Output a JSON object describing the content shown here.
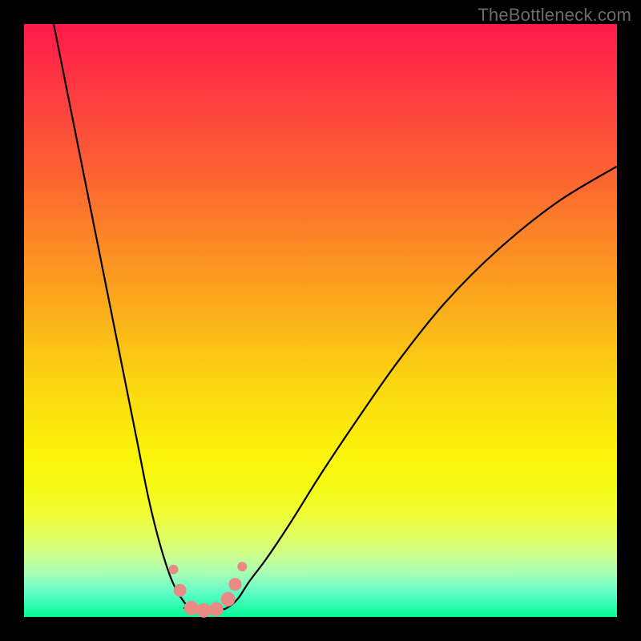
{
  "watermark": {
    "text": "TheBottleneck.com"
  },
  "colors": {
    "frame": "#000000",
    "curve": "#000000",
    "bead": "#e98b84"
  },
  "gradient_stops": [
    {
      "pct": 0,
      "color": "#fe1a4b"
    },
    {
      "pct": 12,
      "color": "#fd3d40"
    },
    {
      "pct": 28,
      "color": "#fc6b2f"
    },
    {
      "pct": 45,
      "color": "#fba31e"
    },
    {
      "pct": 60,
      "color": "#fbd412"
    },
    {
      "pct": 72,
      "color": "#fbf20a"
    },
    {
      "pct": 78,
      "color": "#f6fa14"
    },
    {
      "pct": 83,
      "color": "#edfc3a"
    },
    {
      "pct": 87,
      "color": "#dffe68"
    },
    {
      "pct": 90,
      "color": "#c8fe94"
    },
    {
      "pct": 93,
      "color": "#a0feb9"
    },
    {
      "pct": 96,
      "color": "#5cfec8"
    },
    {
      "pct": 100,
      "color": "#04fa94"
    }
  ],
  "chart_data": {
    "type": "line",
    "title": "",
    "xlabel": "",
    "ylabel": "",
    "xlim": [
      0,
      100
    ],
    "ylim": [
      0,
      100
    ],
    "grid": false,
    "legend_position": "none",
    "series": [
      {
        "name": "left-curve",
        "x": [
          5,
          7,
          9,
          11,
          13,
          15,
          17,
          19,
          21,
          23,
          25,
          27,
          28.5
        ],
        "y": [
          100,
          90,
          80,
          70,
          60,
          50,
          40,
          30,
          20,
          12,
          6,
          2.5,
          1.2
        ]
      },
      {
        "name": "right-curve",
        "x": [
          34,
          36,
          38,
          41,
          45,
          50,
          56,
          63,
          71,
          80,
          90,
          100
        ],
        "y": [
          1.4,
          3,
          6,
          10,
          16,
          24,
          33,
          43,
          53,
          62,
          70,
          76
        ]
      },
      {
        "name": "valley-floor",
        "x": [
          27,
          29,
          31,
          33
        ],
        "y": [
          1.5,
          1.0,
          1.0,
          1.4
        ]
      }
    ],
    "markers": [
      {
        "name": "left-bead-upper",
        "x": 25.2,
        "y": 8.0,
        "r": 6
      },
      {
        "name": "left-bead-lower",
        "x": 26.3,
        "y": 4.5,
        "r": 8
      },
      {
        "name": "floor-bead-1",
        "x": 28.2,
        "y": 1.5,
        "r": 9
      },
      {
        "name": "floor-bead-2",
        "x": 30.3,
        "y": 1.1,
        "r": 9
      },
      {
        "name": "floor-bead-3",
        "x": 32.4,
        "y": 1.3,
        "r": 9
      },
      {
        "name": "right-bead-lower",
        "x": 34.4,
        "y": 3.0,
        "r": 9
      },
      {
        "name": "right-bead-mid",
        "x": 35.6,
        "y": 5.5,
        "r": 8
      },
      {
        "name": "right-bead-upper",
        "x": 36.8,
        "y": 8.5,
        "r": 6
      }
    ]
  }
}
